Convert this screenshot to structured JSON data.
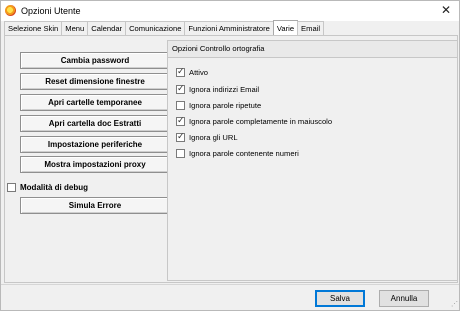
{
  "window": {
    "title": "Opzioni Utente",
    "close_glyph": "✕",
    "app_icon": "app-logo-icon"
  },
  "tabs": [
    {
      "label": "Selezione Skin",
      "active": false
    },
    {
      "label": "Menu",
      "active": false
    },
    {
      "label": "Calendar",
      "active": false
    },
    {
      "label": "Comunicazione",
      "active": false
    },
    {
      "label": "Funzioni Amministratore",
      "active": false
    },
    {
      "label": "Varie",
      "active": true
    },
    {
      "label": "Email",
      "active": false
    }
  ],
  "buttons": {
    "cambia_password": "Cambia password",
    "reset_dimensione": "Reset dimensione finestre",
    "apri_temporanee": "Apri cartelle temporanee",
    "apri_doc_estratti": "Apri cartella doc Estratti",
    "impostazione_periferiche": "Impostazione periferiche",
    "mostra_proxy": "Mostra impostazioni proxy",
    "simula_errore": "Simula Errore"
  },
  "debug": {
    "label": "Modalità di debug",
    "checked": false
  },
  "spellcheck": {
    "header": "Opzioni Controllo ortografia",
    "options": [
      {
        "label": "Attivo",
        "checked": true
      },
      {
        "label": "Ignora indirizzi Email",
        "checked": true
      },
      {
        "label": "Ignora parole ripetute",
        "checked": false
      },
      {
        "label": "Ignora parole completamente in maiuscolo",
        "checked": true
      },
      {
        "label": "Ignora gli URL",
        "checked": true
      },
      {
        "label": "Ignora parole contenente numeri",
        "checked": false
      }
    ]
  },
  "footer": {
    "save_label": "Salva",
    "cancel_label": "Annulla"
  },
  "colors": {
    "accent": "#0078d7",
    "panel_bg": "#f0f0f0"
  }
}
